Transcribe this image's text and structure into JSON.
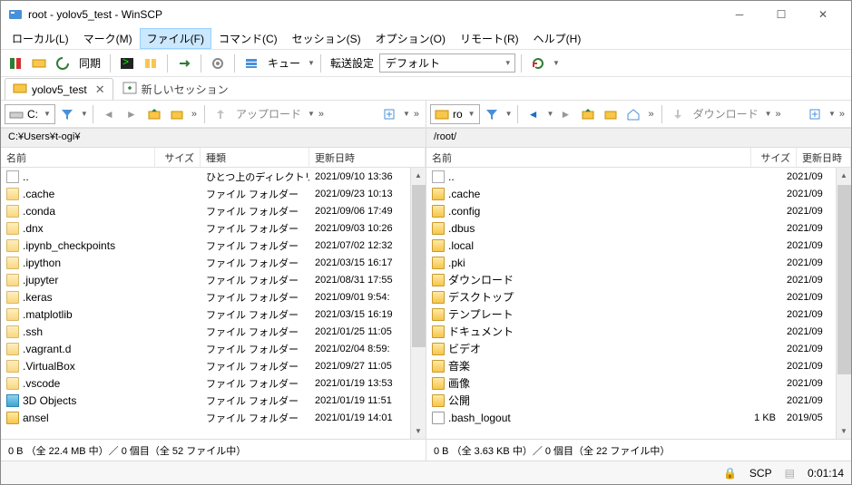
{
  "window": {
    "title": "root - yolov5_test - WinSCP"
  },
  "menu": {
    "items": [
      "ローカル(L)",
      "マーク(M)",
      "ファイル(F)",
      "コマンド(C)",
      "セッション(S)",
      "オプション(O)",
      "リモート(R)",
      "ヘルプ(H)"
    ],
    "active_index": 2
  },
  "toolbar1": {
    "sync": "同期",
    "queue": "キュー",
    "transfer_label": "転送設定",
    "transfer_preset": "デフォルト"
  },
  "tabs": {
    "active": "yolov5_test",
    "new": "新しいセッション"
  },
  "left": {
    "drive": "C:",
    "upload": "アップロード",
    "path": "C:¥Users¥t-ogi¥",
    "cols": {
      "name": "名前",
      "size": "サイズ",
      "type": "種類",
      "date": "更新日時"
    },
    "rows": [
      {
        "icon": "up",
        "name": "..",
        "type": "ひとつ上のディレクトリ",
        "date": "2021/09/10 13:36"
      },
      {
        "icon": "folder-h",
        "name": ".cache",
        "type": "ファイル フォルダー",
        "date": "2021/09/23 10:13"
      },
      {
        "icon": "folder-h",
        "name": ".conda",
        "type": "ファイル フォルダー",
        "date": "2021/09/06 17:49"
      },
      {
        "icon": "folder-h",
        "name": ".dnx",
        "type": "ファイル フォルダー",
        "date": "2021/09/03 10:26"
      },
      {
        "icon": "folder-h",
        "name": ".ipynb_checkpoints",
        "type": "ファイル フォルダー",
        "date": "2021/07/02 12:32"
      },
      {
        "icon": "folder-h",
        "name": ".ipython",
        "type": "ファイル フォルダー",
        "date": "2021/03/15 16:17"
      },
      {
        "icon": "folder-h",
        "name": ".jupyter",
        "type": "ファイル フォルダー",
        "date": "2021/08/31 17:55"
      },
      {
        "icon": "folder-h",
        "name": ".keras",
        "type": "ファイル フォルダー",
        "date": "2021/09/01 9:54:"
      },
      {
        "icon": "folder-h",
        "name": ".matplotlib",
        "type": "ファイル フォルダー",
        "date": "2021/03/15 16:19"
      },
      {
        "icon": "folder-h",
        "name": ".ssh",
        "type": "ファイル フォルダー",
        "date": "2021/01/25 11:05"
      },
      {
        "icon": "folder-h",
        "name": ".vagrant.d",
        "type": "ファイル フォルダー",
        "date": "2021/02/04 8:59:"
      },
      {
        "icon": "folder-h",
        "name": ".VirtualBox",
        "type": "ファイル フォルダー",
        "date": "2021/09/27 11:05"
      },
      {
        "icon": "folder-h",
        "name": ".vscode",
        "type": "ファイル フォルダー",
        "date": "2021/01/19 13:53"
      },
      {
        "icon": "cube",
        "name": "3D Objects",
        "type": "ファイル フォルダー",
        "date": "2021/01/19 11:51"
      },
      {
        "icon": "folder",
        "name": "ansel",
        "type": "ファイル フォルダー",
        "date": "2021/01/19 14:01"
      }
    ],
    "status": "0 B （全 22.4 MB 中）／ 0 個目（全 52 ファイル中）"
  },
  "right": {
    "drive": "ro",
    "download": "ダウンロード",
    "path": "/root/",
    "cols": {
      "name": "名前",
      "size": "サイズ",
      "date": "更新日時"
    },
    "rows": [
      {
        "icon": "up",
        "name": "..",
        "size": "",
        "date": "2021/09"
      },
      {
        "icon": "folder",
        "name": ".cache",
        "size": "",
        "date": "2021/09"
      },
      {
        "icon": "folder",
        "name": ".config",
        "size": "",
        "date": "2021/09"
      },
      {
        "icon": "folder",
        "name": ".dbus",
        "size": "",
        "date": "2021/09"
      },
      {
        "icon": "folder",
        "name": ".local",
        "size": "",
        "date": "2021/09"
      },
      {
        "icon": "folder",
        "name": ".pki",
        "size": "",
        "date": "2021/09"
      },
      {
        "icon": "folder",
        "name": "ダウンロード",
        "size": "",
        "date": "2021/09"
      },
      {
        "icon": "folder",
        "name": "デスクトップ",
        "size": "",
        "date": "2021/09"
      },
      {
        "icon": "folder",
        "name": "テンプレート",
        "size": "",
        "date": "2021/09"
      },
      {
        "icon": "folder",
        "name": "ドキュメント",
        "size": "",
        "date": "2021/09"
      },
      {
        "icon": "folder",
        "name": "ビデオ",
        "size": "",
        "date": "2021/09"
      },
      {
        "icon": "folder",
        "name": "音楽",
        "size": "",
        "date": "2021/09"
      },
      {
        "icon": "folder",
        "name": "画像",
        "size": "",
        "date": "2021/09"
      },
      {
        "icon": "folder",
        "name": "公開",
        "size": "",
        "date": "2021/09"
      },
      {
        "icon": "file",
        "name": ".bash_logout",
        "size": "1 KB",
        "date": "2019/05"
      }
    ],
    "status": "0 B （全 3.63 KB 中）／ 0 個目（全 22 ファイル中）"
  },
  "bottom": {
    "protocol": "SCP",
    "time": "0:01:14"
  }
}
